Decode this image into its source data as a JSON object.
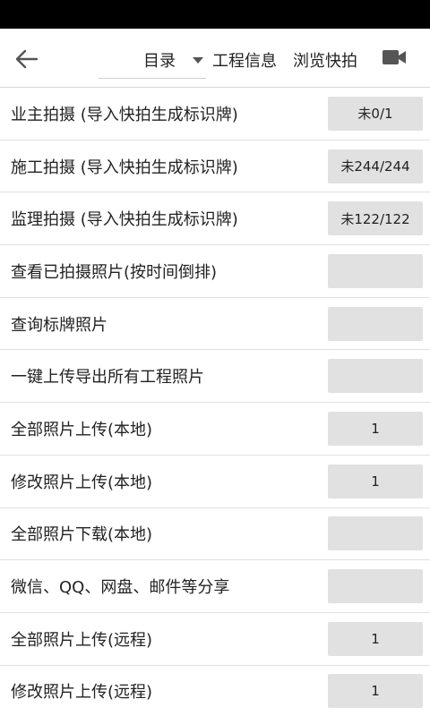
{
  "toolbar": {
    "dropdown_label": "目录",
    "tab_info": "工程信息",
    "tab_browse": "浏览快拍"
  },
  "rows": [
    {
      "label": "业主拍摄 (导入快拍生成标识牌)",
      "badge": "未0/1"
    },
    {
      "label": "施工拍摄 (导入快拍生成标识牌)",
      "badge": "未244/244"
    },
    {
      "label": "监理拍摄 (导入快拍生成标识牌)",
      "badge": "未122/122"
    },
    {
      "label": "查看已拍摄照片(按时间倒排)",
      "badge": ""
    },
    {
      "label": "查询标牌照片",
      "badge": ""
    },
    {
      "label": "一键上传导出所有工程照片",
      "badge": ""
    },
    {
      "label": "全部照片上传(本地)",
      "badge": "1"
    },
    {
      "label": "修改照片上传(本地)",
      "badge": "1"
    },
    {
      "label": "全部照片下载(本地)",
      "badge": ""
    },
    {
      "label": "微信、QQ、网盘、邮件等分享",
      "badge": ""
    },
    {
      "label": "全部照片上传(远程)",
      "badge": "1"
    },
    {
      "label": "修改照片上传(远程)",
      "badge": "1"
    }
  ],
  "icons": {
    "back": "arrow-left-icon",
    "video": "video-camera-icon"
  },
  "colors": {
    "status_bar": "#000000",
    "badge_bg": "#e1e1e1",
    "divider": "#e0e0e0"
  }
}
